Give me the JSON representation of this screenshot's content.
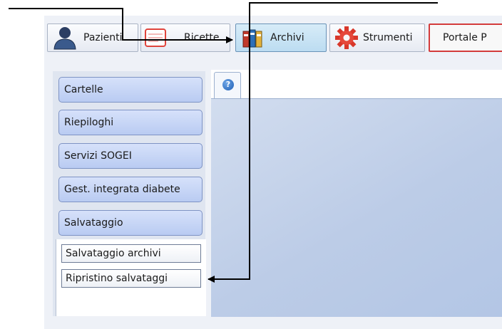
{
  "toolbar": {
    "pazienti_label": "Pazienti",
    "ricette_label": "Ricette",
    "archivi_label": "Archivi",
    "strumenti_label": "Strumenti",
    "portale_label": "Portale P"
  },
  "sidebar": {
    "items": [
      {
        "label": "Cartelle"
      },
      {
        "label": "Riepiloghi"
      },
      {
        "label": "Servizi SOGEI"
      },
      {
        "label": "Gest. integrata diabete"
      },
      {
        "label": "Salvataggio"
      }
    ],
    "sub_items": [
      {
        "label": "Salvataggio archivi"
      },
      {
        "label": "Ripristino salvataggi"
      }
    ]
  },
  "main": {
    "help_tab_glyph": "?"
  },
  "colors": {
    "accent_arrow": "#000000",
    "portale_border": "#d33b3b",
    "side_button": "#c6d5f5",
    "content_bg": "#c4d3ec"
  },
  "icons": [
    "user-icon",
    "prescription-icon",
    "binders-icon",
    "gear-icon",
    "help-icon",
    "arrow-icon"
  ]
}
